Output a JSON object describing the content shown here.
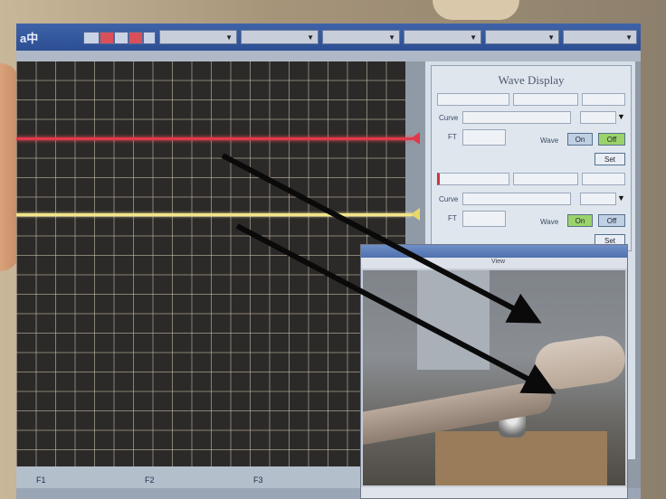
{
  "toolbar": {
    "title": "a中",
    "dropdowns": [
      "",
      "",
      "",
      "",
      "",
      "",
      ""
    ]
  },
  "wave_display": {
    "title": "Wave Display",
    "channel1": {
      "curve_label": "Curve",
      "ft_label": "FT",
      "wave_label": "Wave",
      "on_label": "On",
      "off_label": "Off",
      "set_label": "Set"
    },
    "channel2": {
      "curve_label": "Curve",
      "ft_label": "FT",
      "wave_label": "Wave",
      "on_label": "On",
      "off_label": "Off",
      "set_label": "Set"
    }
  },
  "camera_window": {
    "menu": [
      "",
      "",
      "",
      "",
      "",
      "View"
    ]
  },
  "function_keys": [
    "F1",
    "F2",
    "F3"
  ],
  "colors": {
    "trace_red": "#e0394a",
    "trace_yellow": "#f2e58a",
    "grid": "#2c2a28",
    "toolbar": "#2c4e93",
    "on_button": "#9bd36a"
  }
}
